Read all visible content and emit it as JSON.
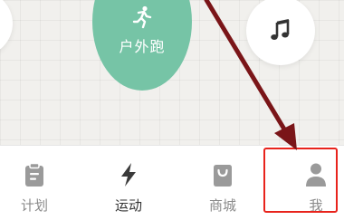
{
  "main": {
    "run_button_label": "户外跑",
    "music_icon": "music-note-icon",
    "run_icon": "running-person-icon"
  },
  "tabs": [
    {
      "label": "计划",
      "icon": "clipboard-icon",
      "active": false
    },
    {
      "label": "运动",
      "icon": "lightning-icon",
      "active": true
    },
    {
      "label": "商城",
      "icon": "shopping-bag-icon",
      "active": false
    },
    {
      "label": "我",
      "icon": "person-icon",
      "active": false
    }
  ],
  "colors": {
    "accent_green": "#76c4a6",
    "highlight_red": "#e8231c",
    "arrow_dark_red": "#7a1518",
    "inactive_tab": "#8a8a8a",
    "active_tab": "#333333"
  }
}
